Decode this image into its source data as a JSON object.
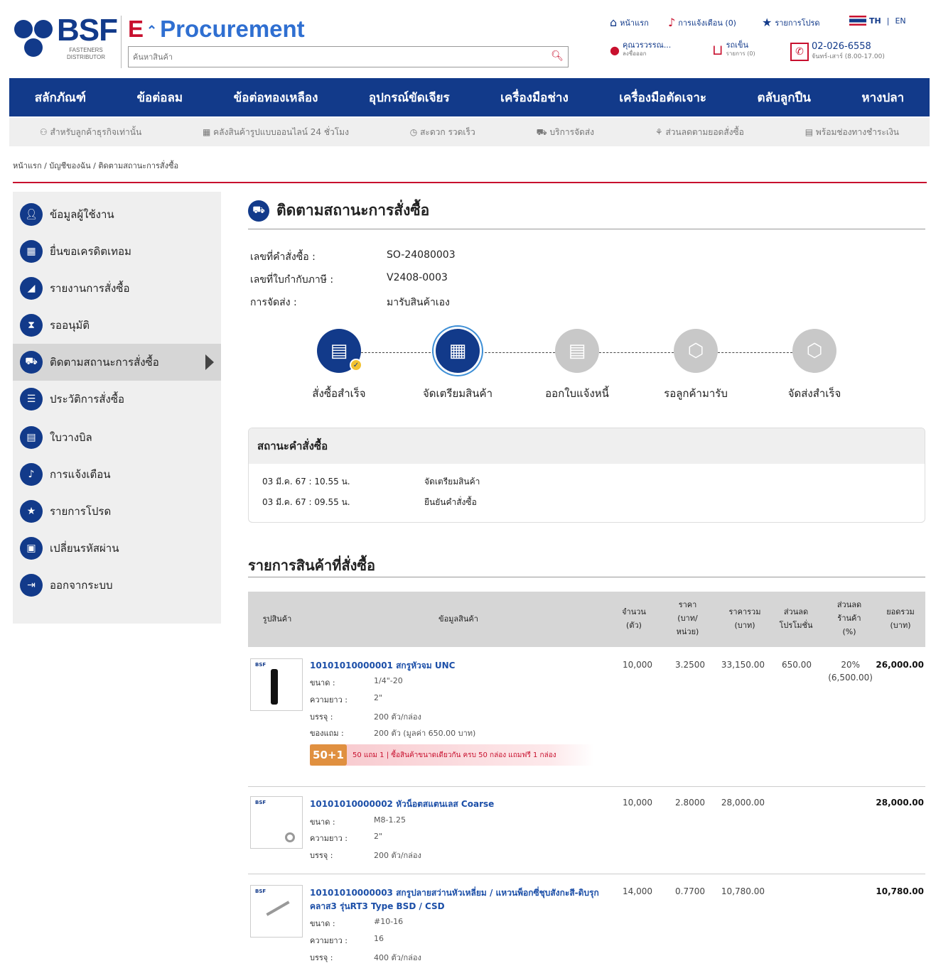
{
  "header": {
    "brand": "BSF",
    "brand_sub_line1": "FASTENERS",
    "brand_sub_line2": "DISTRIBUTOR",
    "eproc_e": "E",
    "eproc_text": "Procurement",
    "search_placeholder": "ค้นหาสินค้า",
    "home": "หน้าแรก",
    "notifications": "การแจ้งเตือน (0)",
    "favorites": "รายการโปรด",
    "lang_th": "TH",
    "lang_sep": "|",
    "lang_en": "EN",
    "user_name": "คุณวรวรรณ...",
    "user_sub": "ลงชื่อออก",
    "cart_label": "รถเข็น",
    "cart_sub": "รายการ (0)",
    "phone": "02-026-6558",
    "hours": "จันทร์-เสาร์ (8.00-17.00)"
  },
  "categories": [
    "สลักภัณฑ์",
    "ข้อต่อลม",
    "ข้อต่อทองเหลือง",
    "อุปกรณ์ขัดเจียร",
    "เครื่องมือช่าง",
    "เครื่องมือตัดเจาะ",
    "ตลับลูกปืน",
    "หางปลา"
  ],
  "benefits": [
    "สำหรับลูกค้าธุรกิจเท่านั้น",
    "คลังสินค้ารูปแบบออนไลน์ 24 ชั่วโมง",
    "สะดวก รวดเร็ว",
    "บริการจัดส่ง",
    "ส่วนลดตามยอดสั่งซื้อ",
    "พร้อมช่องทางชำระเงิน"
  ],
  "breadcrumb": "หน้าแรก / บัญชีของฉัน / ติดตามสถานะการสั่งซื้อ",
  "sidebar": {
    "items": [
      {
        "label": "ข้อมูลผู้ใช้งาน"
      },
      {
        "label": "ยื่นขอเครดิตเทอม"
      },
      {
        "label": "รายงานการสั่งซื้อ"
      },
      {
        "label": "รออนุมัติ"
      },
      {
        "label": "ติดตามสถานะการสั่งซื้อ"
      },
      {
        "label": "ประวัติการสั่งซื้อ"
      },
      {
        "label": "ใบวางบิล"
      },
      {
        "label": "การแจ้งเตือน"
      },
      {
        "label": "รายการโปรด"
      },
      {
        "label": "เปลี่ยนรหัสผ่าน"
      },
      {
        "label": "ออกจากระบบ"
      }
    ]
  },
  "main": {
    "title": "ติดตามสถานะการสั่งซื้อ",
    "order_no_label": "เลขที่คำสั่งซื้อ :",
    "order_no": "SO-24080003",
    "tax_no_label": "เลขที่ใบกำกับภาษี :",
    "tax_no": "V2408-0003",
    "delivery_label": "การจัดส่ง :",
    "delivery": "มารับสินค้าเอง",
    "steps": [
      {
        "label": "สั่งซื้อสำเร็จ",
        "state": "done"
      },
      {
        "label": "จัดเตรียมสินค้า",
        "state": "current"
      },
      {
        "label": "ออกใบแจ้งหนี้",
        "state": "pending"
      },
      {
        "label": "รอลูกค้ามารับ",
        "state": "pending"
      },
      {
        "label": "จัดส่งสำเร็จ",
        "state": "pending"
      }
    ],
    "status_title": "สถานะคำสั่งซื้อ",
    "status_rows": [
      {
        "time": "03 มี.ค. 67 : 10.55 น.",
        "text": "จัดเตรียมสินค้า"
      },
      {
        "time": "03 มี.ค. 67 : 09.55 น.",
        "text": "ยืนยันคำสั่งซื้อ"
      }
    ],
    "items_title": "รายการสินค้าที่สั่งซื้อ"
  },
  "table": {
    "headers": {
      "image": "รูปสินค้า",
      "info": "ข้อมูลสินค้า",
      "qty_1": "จำนวน",
      "qty_2": "(ตัว)",
      "price_1": "ราคา",
      "price_2": "(บาท/",
      "price_3": "หน่วย)",
      "total_1": "ราคารวม",
      "total_2": "(บาท)",
      "promo_1": "ส่วนลด",
      "promo_2": "โปรโมชั่น",
      "shop_1": "ส่วนลด",
      "shop_2": "ร้านค้า",
      "shop_3": "(%)",
      "net_1": "ยอดรวม",
      "net_2": "(บาท)"
    },
    "spec_labels": {
      "size": "ขนาด :",
      "length": "ความยาว :",
      "pack": "บรรจุ :",
      "gift": "ของแถม :"
    },
    "rows": [
      {
        "name": "10101010000001 สกรูหัวจม UNC",
        "size": "1/4\"-20",
        "length": "2\"",
        "pack": "200 ตัว/กล่อง",
        "gift": "200 ตัว (มูลค่า 650.00 บาท)",
        "qty": "10,000",
        "price": "3.2500",
        "total": "33,150.00",
        "promo_discount": "650.00",
        "shop_discount": "20%",
        "shop_discount_amt": "(6,500.00)",
        "net": "26,000.00",
        "promo_badge": "50+1",
        "promo_text": "50 แถม 1 | ซื้อสินค้าขนาดเดียวกัน ครบ 50 กล่อง แถมฟรี 1 กล่อง"
      },
      {
        "name": "10101010000002 หัวน็อตสแตนเลส Coarse",
        "size": "M8-1.25",
        "length": "2\"",
        "pack": "200 ตัว/กล่อง",
        "qty": "10,000",
        "price": "2.8000",
        "total": "28,000.00",
        "net": "28,000.00"
      },
      {
        "name_line1": "10101010000003 สกรูปลายสว่านหัวเหลี่ยม / แหวนพ็อกซี่ชุบสังกะสี-ดิบรุก",
        "name_line2": "คลาส3 รุ่นRT3 Type BSD / CSD",
        "size": "#10-16",
        "length": "16",
        "pack": "400 ตัว/กล่อง",
        "qty": "14,000",
        "price": "0.7700",
        "total": "10,780.00",
        "net": "10,780.00"
      }
    ]
  },
  "colors": {
    "brand_navy": "#123a8a",
    "accent_red": "#c8102e",
    "link_blue": "#2f6fd1"
  },
  "icons": [
    "home-icon",
    "bell-icon",
    "star-icon",
    "thai-flag-icon",
    "user-icon",
    "cart-icon",
    "phone-icon",
    "search-icon"
  ]
}
